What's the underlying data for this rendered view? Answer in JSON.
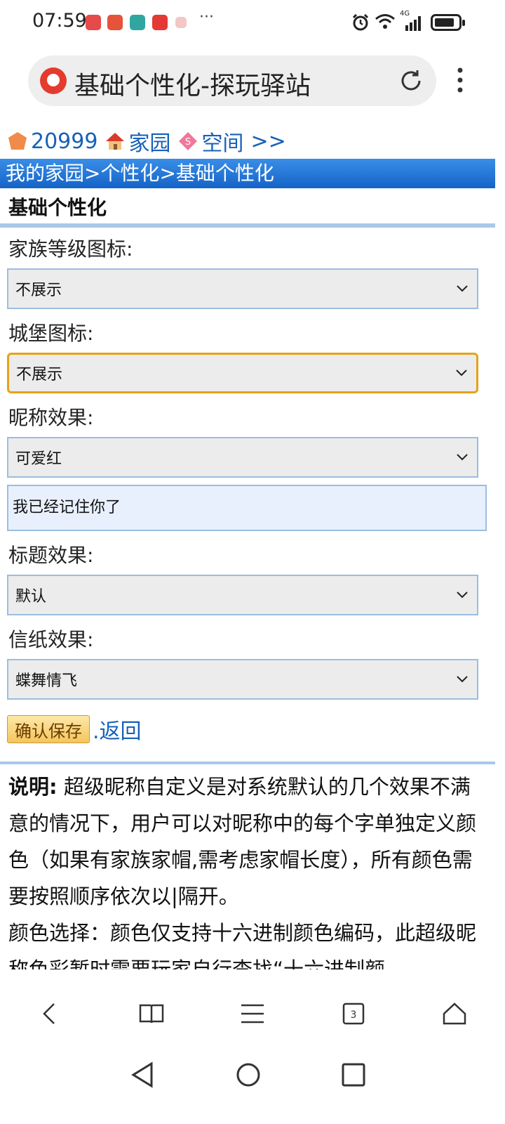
{
  "status": {
    "time": "07:59",
    "more": "···",
    "network": "4G"
  },
  "browser": {
    "page_title": "基础个性化-探玩驿站",
    "tab_count": "3"
  },
  "top_links": {
    "count": "20999",
    "home": "家园",
    "space": "空间",
    "more": ">>"
  },
  "breadcrumb": "我的家园>个性化>基础个性化",
  "section_title": "基础个性化",
  "form": {
    "clan_icon": {
      "label": "家族等级图标:",
      "value": "不展示"
    },
    "castle_icon": {
      "label": "城堡图标:",
      "value": "不展示"
    },
    "nickname_effect": {
      "label": "昵称效果:",
      "value": "可爱红"
    },
    "remember_text": "我已经记住你了",
    "title_effect": {
      "label": "标题效果:",
      "value": "默认"
    },
    "letter_effect": {
      "label": "信纸效果:",
      "value": "蝶舞情飞"
    },
    "save_label": "确认保存",
    "back_label": ".返回"
  },
  "description": {
    "heading": "说明:",
    "para1": "超级昵称自定义是对系统默认的几个效果不满意的情况下，用户可以对昵称中的每个字单独定义颜色（如果有家族家帽,需考虑家帽长度），所有颜色需要按照顺序依次以|隔开。",
    "para2": "颜色选择：颜色仅支持十六进制颜色编码，此超级昵称色彩暂时需要玩家自行查找“十六进制颜"
  },
  "colors": {
    "link": "#1761b8",
    "breadcrumb_bg": "#1464c8",
    "focus_border": "#e5a21a",
    "divider": "#a9c8ea"
  }
}
